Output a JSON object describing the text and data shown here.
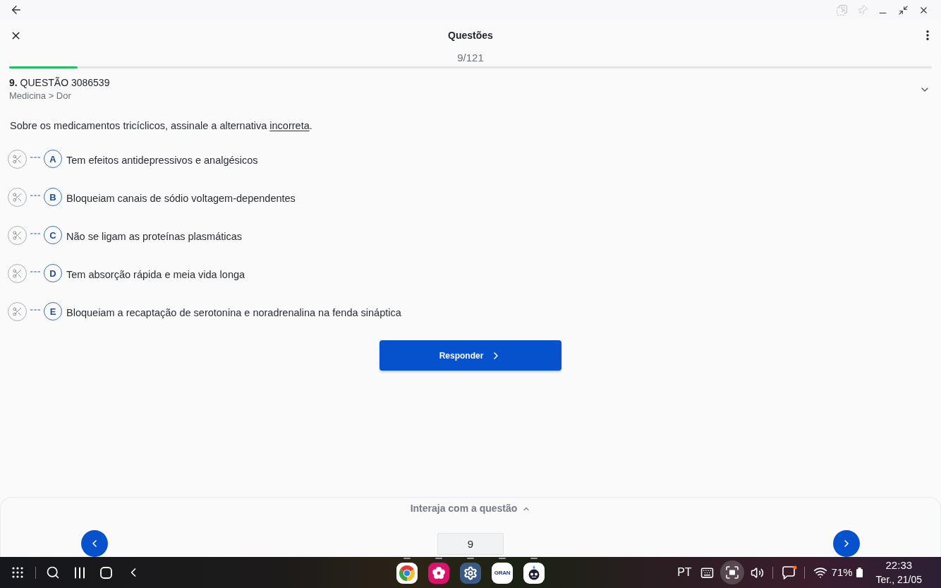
{
  "header": {
    "title": "Questões",
    "counter": "9/121",
    "progress": {
      "level": 0.0744
    }
  },
  "question": {
    "heading": "**9.** QUESTÃO 3086539",
    "breadcrumb": "Medicina > Dor",
    "statement": [
      {
        "text": "Sobre os medicamentos tricíclicos, assinale a alternativa ",
        "underline": false
      },
      {
        "text": "incorreta",
        "underline": true
      },
      {
        "text": ".",
        "underline": false
      }
    ],
    "alternatives": [
      {
        "letter": "A",
        "text": "Tem efeitos antidepressivos e analgésicos",
        "selected": false
      },
      {
        "letter": "B",
        "text": "Bloqueiam canais de sódio voltagem-dependentes",
        "selected": false
      },
      {
        "letter": "C",
        "text": "Não se ligam as proteínas plasmáticas",
        "selected": false
      },
      {
        "letter": "D",
        "text": "Tem absorção rápida e meia vida longa",
        "selected": false
      },
      {
        "letter": "E",
        "text": "Bloqueiam a recaptação de serotonina e noradrenalina na fenda sináptica",
        "selected": false
      }
    ],
    "submit": "Responder"
  },
  "footer": {
    "toggle": "Interaja com a questão",
    "page_field": {
      "value": "9"
    }
  },
  "taskbar": {
    "apps": [
      {
        "kind": "browser"
      },
      {
        "kind": "flower"
      },
      {
        "kind": "settings"
      },
      {
        "kind": "text_logo",
        "label": "GRAN"
      },
      {
        "kind": "robot"
      }
    ],
    "language": "PT",
    "messages": {
      "unread": true
    },
    "battery": "71%",
    "time": "22:33",
    "date": "Ter., 21/05"
  }
}
